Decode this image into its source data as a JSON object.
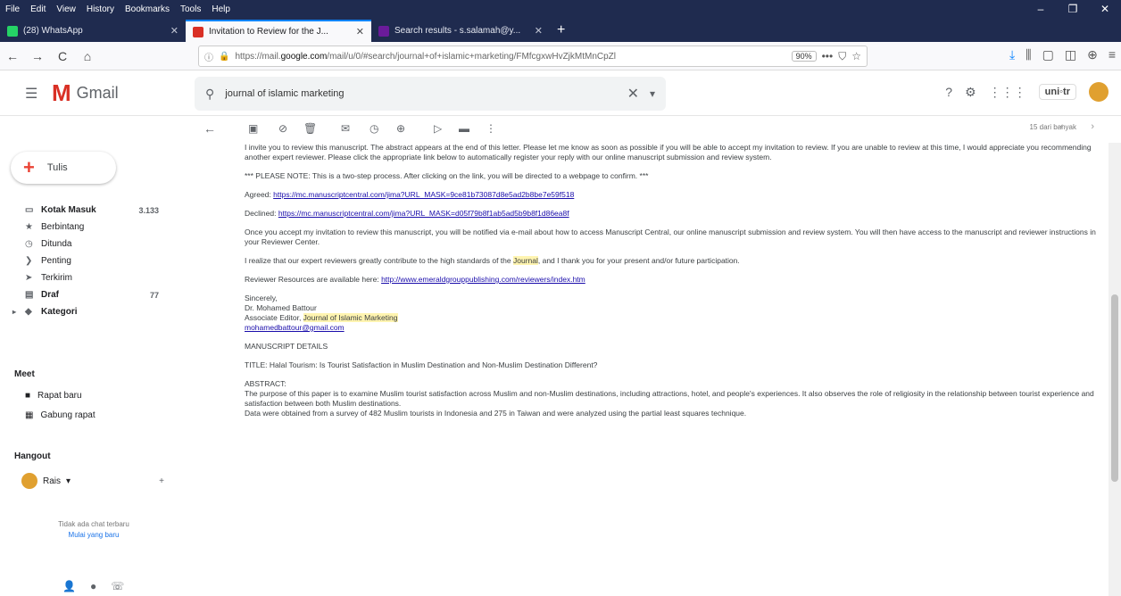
{
  "browser": {
    "menu": [
      "File",
      "Edit",
      "View",
      "History",
      "Bookmarks",
      "Tools",
      "Help"
    ],
    "window_buttons": [
      "–",
      "❐",
      "✕"
    ],
    "tabs": [
      {
        "label": "(28) WhatsApp",
        "close": "✕",
        "fav_color": "#25d366"
      },
      {
        "label": "Invitation to Review for the J...",
        "close": "✕",
        "fav_color": "#d93025"
      },
      {
        "label": "Search results - s.salamah@y...",
        "close": "✕",
        "fav_color": "#6a1b9a"
      }
    ],
    "new_tab": "+",
    "nav": {
      "back": "←",
      "forward": "→",
      "reload": "C",
      "home": "⌂"
    },
    "url_prefix": "https://mail.",
    "url_domain": "google.com",
    "url_rest": "/mail/u/0/#search/journal+of+islamic+marketing/FMfcgxwHvZjkMtMnCpZl",
    "zoom": "90%",
    "url_buttons": [
      "•••",
      "⛉",
      "☆"
    ],
    "right_icons": [
      "⤓",
      "⫼",
      "▢",
      "◫",
      "⊕",
      "≡"
    ]
  },
  "gmail": {
    "logo_text": "Gmail",
    "search_value": "journal of islamic marketing",
    "search_clear": "✕",
    "search_options": "▾",
    "header_icons": [
      "?",
      "⚙",
      "⋮⋮⋮"
    ],
    "account_badge": "uni◦tr"
  },
  "sidebar": {
    "compose": "Tulis",
    "items": [
      {
        "icon": "▭",
        "label": "Kotak Masuk",
        "count": "3.133",
        "bold": true
      },
      {
        "icon": "★",
        "label": "Berbintang",
        "count": ""
      },
      {
        "icon": "◷",
        "label": "Ditunda",
        "count": ""
      },
      {
        "icon": "❯",
        "label": "Penting",
        "count": ""
      },
      {
        "icon": "➤",
        "label": "Terkirim",
        "count": ""
      },
      {
        "icon": "▤",
        "label": "Draf",
        "count": "77",
        "bold": true
      },
      {
        "icon": "◆",
        "label": "Kategori",
        "count": "",
        "bold": true
      }
    ],
    "meet_title": "Meet",
    "meet_items": [
      {
        "icon": "■",
        "label": "Rapat baru"
      },
      {
        "icon": "▦",
        "label": "Gabung rapat"
      }
    ],
    "hangout_title": "Hangout",
    "hangout_user": "Rais",
    "hangout_add": "+",
    "nochat_line": "Tidak ada chat terbaru",
    "nochat_link": "Mulai yang baru",
    "bottom_icons": [
      "👤",
      "●",
      "☏"
    ]
  },
  "toolbar": {
    "back": "←",
    "icons": [
      "▣",
      "⊘",
      "🗑",
      "✉",
      "◷",
      "⊕",
      "▷",
      "▬",
      "⋮"
    ],
    "pager": "15 dari banyak",
    "pager_buttons": "‹ ›"
  },
  "mail": {
    "p1": "I invite you to review this manuscript. The abstract appears at the end of this letter. Please let me know as soon as possible if you will be able to accept my invitation to review. If you are unable to review at this time, I would appreciate you recommending another expert reviewer. Please click the appropriate link below to automatically register your reply with our online manuscript submission and review system.",
    "p2": "*** PLEASE NOTE: This is a two-step process. After clicking on the link, you will be directed to a webpage to confirm. ***",
    "agreed_label": "Agreed:",
    "agreed_link": "https://mc.manuscriptcentral.com/jima?URL_MASK=9ce81b73087d8e5ad2b8be7e59f518",
    "declined_label": "Declined:",
    "declined_link": "https://mc.manuscriptcentral.com/jima?URL_MASK=d05f79b8f1ab5ad5b9b8f1d86ea8f",
    "p3": "Once you accept my invitation to review this manuscript, you will be notified via e-mail about how to access Manuscript Central, our online manuscript submission and review system. You will then have access to the manuscript and reviewer instructions in your Reviewer Center.",
    "p4a": "I realize that our expert reviewers greatly contribute to the high standards of the ",
    "p4_hl": "Journal",
    "p4b": ", and I thank you for your present and/or future participation.",
    "resources_label": "Reviewer Resources are available here: ",
    "resources_link": "http://www.emeraldgrouppublishing.com/reviewers/index.htm",
    "sig1": "Sincerely,",
    "sig2": "Dr. Mohamed Battour",
    "sig3a": "Associate Editor, ",
    "sig3_hl": "Journal of Islamic Marketing",
    "sig_email": "mohamedbattour@gmail.com",
    "details": "MANUSCRIPT DETAILS",
    "title_line": "TITLE: Halal Tourism: Is Tourist Satisfaction in Muslim Destination and Non-Muslim Destination Different?",
    "abstract_head": "ABSTRACT:",
    "abstract1": "The purpose of this paper is to examine Muslim tourist satisfaction across Muslim and non-Muslim destinations, including attractions, hotel, and people's experiences. It also observes the role of religiosity in the relationship between tourist experience and satisfaction between both Muslim destinations.",
    "abstract2": "Data were obtained from a survey of 482 Muslim tourists in Indonesia and 275 in Taiwan and were analyzed using the partial least squares technique."
  }
}
